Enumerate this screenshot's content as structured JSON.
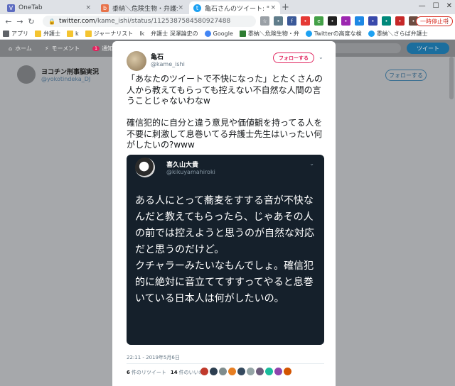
{
  "browser": {
    "tabs": [
      {
        "title": "OneTab",
        "icon_color": "#5c6bc0",
        "active": false
      },
      {
        "title": "黍納＼危険生物・弁護士脳汚染",
        "icon_color": "#e8734a",
        "active": false
      },
      {
        "title": "亀石さんのツイート: \"「あなたのツ",
        "icon_color": "#1da1f2",
        "active": true
      }
    ],
    "close_glyph": "×",
    "new_tab_glyph": "+",
    "window_buttons": [
      "—",
      "☐",
      "✕"
    ],
    "nav": {
      "back": "←",
      "forward": "→",
      "reload": "↻"
    },
    "address": {
      "host": "twitter.com",
      "path": "/kame_ishi/status/1125387584580927488"
    },
    "paused_label": "一時停止中",
    "menu_glyph": "⋮"
  },
  "bookmarks": [
    {
      "label": "アプリ",
      "icon": "grid-icon"
    },
    {
      "label": "弁護士",
      "icon": "folder-icon"
    },
    {
      "label": "k",
      "icon": "folder-icon"
    },
    {
      "label": "ジャーナリスト",
      "icon": "folder-icon"
    },
    {
      "label": "lk",
      "icon": "page-icon"
    },
    {
      "label": "弁護士 深澤論史の",
      "icon": "page-icon"
    },
    {
      "label": "Google",
      "icon": "google-icon"
    },
    {
      "label": "黍納＼危険生物・弁",
      "icon": "page-icon"
    },
    {
      "label": "Twitterの高度な検",
      "icon": "twitter-icon"
    },
    {
      "label": "黍納＼さらば弁護士",
      "icon": "twitter-icon"
    }
  ],
  "twitter_nav": {
    "items": [
      {
        "label": "ホーム",
        "glyph": "⌂"
      },
      {
        "label": "モーメント",
        "glyph": "⚡"
      },
      {
        "label": "通知",
        "glyph": "🔔",
        "badge": "1"
      }
    ],
    "tweet_button": "ツイート"
  },
  "background_profile": {
    "name": "ヨコチン刑事脳実況",
    "handle": "@yokotindeka_DJ",
    "follow_label": "フォローする"
  },
  "tweet": {
    "author_name": "亀石",
    "author_handle": "@kame_ishi",
    "follow_label": "フォローする",
    "text": "「あなたのツイートで不快になった」とたくさんの人から教えてもらっても控えない不自然な人間の言うことじゃないわなw\n\n確信犯的に自分と違う意見や価値観を持ってる人を不要に刺激して息巻いてる弁護士先生はいったい何がしたいの?www",
    "quoted": {
      "author_name": "喜久山大貴",
      "author_handle": "@kikuyamahiroki",
      "text": "ある人にとって蕎麦をすする音が不快なんだと教えてもらったら、じゃあその人の前では控えようと思うのが自然な対応だと思うのだけど。\nクチャラーみたいなもんでしょ。確信犯的に絶対に音立ててすすってやると息巻いている日本人は何がしたいの。"
    },
    "timestamp": "22:11 - 2019年5月6日",
    "retweets_count": "6",
    "retweets_label": "件のリツイート",
    "likes_count": "14",
    "likes_label": "件のいいね",
    "liker_colors": [
      "#c0392b",
      "#2c3e50",
      "#7f8c8d",
      "#e67e22",
      "#34495e",
      "#95a5a6",
      "#6c5b7b",
      "#1abc9c",
      "#8e44ad",
      "#d35400"
    ]
  }
}
